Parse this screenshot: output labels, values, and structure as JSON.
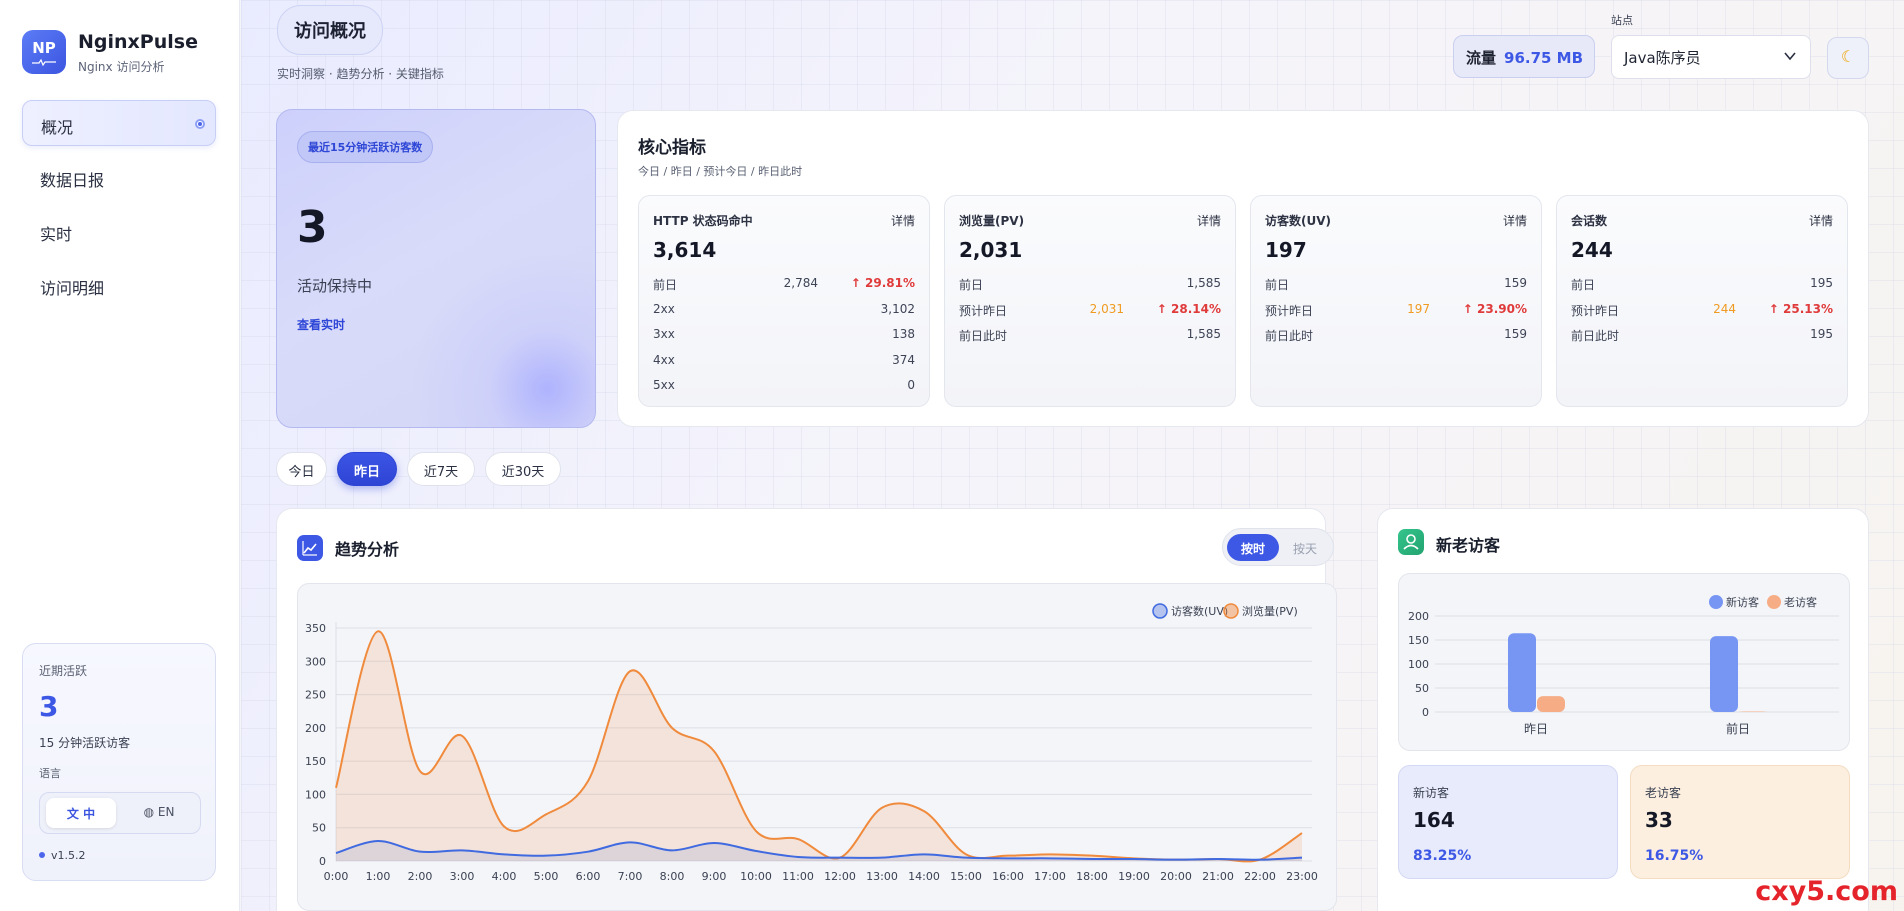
{
  "app": {
    "logo": "NP",
    "name": "NginxPulse",
    "subtitle": "Nginx 访问分析"
  },
  "nav": [
    {
      "label": "概况",
      "active": true
    },
    {
      "label": "数据日报",
      "active": false
    },
    {
      "label": "实时",
      "active": false
    },
    {
      "label": "访问明细",
      "active": false
    }
  ],
  "sidebar_card": {
    "title": "近期活跃",
    "value": "3",
    "desc": "15 分钟活跃访客",
    "lang_label": "语言",
    "lang_zh": "中",
    "lang_en": "EN",
    "version": "v1.5.2"
  },
  "header": {
    "title": "访问概况",
    "subtitle": "实时洞察 · 趋势分析 · 关键指标",
    "traffic_label": "流量",
    "traffic_value": "96.75 MB",
    "site_label": "站点",
    "site_value": "Java陈序员"
  },
  "active_card": {
    "badge": "最近15分钟活跃访客数",
    "value": "3",
    "status": "活动保持中",
    "link": "查看实时"
  },
  "core": {
    "title": "核心指标",
    "subtitle": "今日 / 昨日 / 预计今日 / 昨日此时",
    "detail_label": "详情",
    "metrics": [
      {
        "title": "HTTP 状态码命中",
        "value": "3,614",
        "rows": [
          {
            "label": "前日",
            "mid": "2,784",
            "right": "↑ 29.81%",
            "right_class": "red"
          },
          {
            "label": "2xx",
            "mid": "",
            "right": "3,102",
            "right_class": ""
          },
          {
            "label": "3xx",
            "mid": "",
            "right": "138",
            "right_class": ""
          },
          {
            "label": "4xx",
            "mid": "",
            "right": "374",
            "right_class": ""
          },
          {
            "label": "5xx",
            "mid": "",
            "right": "0",
            "right_class": ""
          }
        ]
      },
      {
        "title": "浏览量(PV)",
        "value": "2,031",
        "rows": [
          {
            "label": "前日",
            "mid": "",
            "right": "1,585",
            "right_class": ""
          },
          {
            "label": "预计昨日",
            "mid": "2,031",
            "right": "↑ 28.14%",
            "right_class": "red"
          },
          {
            "label": "前日此时",
            "mid": "",
            "right": "1,585",
            "right_class": ""
          }
        ]
      },
      {
        "title": "访客数(UV)",
        "value": "197",
        "rows": [
          {
            "label": "前日",
            "mid": "",
            "right": "159",
            "right_class": ""
          },
          {
            "label": "预计昨日",
            "mid": "197",
            "right": "↑ 23.90%",
            "right_class": "red"
          },
          {
            "label": "前日此时",
            "mid": "",
            "right": "159",
            "right_class": ""
          }
        ]
      },
      {
        "title": "会话数",
        "value": "244",
        "rows": [
          {
            "label": "前日",
            "mid": "",
            "right": "195",
            "right_class": ""
          },
          {
            "label": "预计昨日",
            "mid": "244",
            "right": "↑ 25.13%",
            "right_class": "red"
          },
          {
            "label": "前日此时",
            "mid": "",
            "right": "195",
            "right_class": ""
          }
        ]
      }
    ]
  },
  "range_tabs": [
    {
      "label": "今日",
      "selected": false
    },
    {
      "label": "昨日",
      "selected": true
    },
    {
      "label": "近7天",
      "selected": false
    },
    {
      "label": "近30天",
      "selected": false
    }
  ],
  "trend": {
    "title": "趋势分析",
    "toggle_on": "按时",
    "toggle_off": "按天"
  },
  "visitors": {
    "title": "新老访客",
    "new_label": "新访客",
    "new_value": "164",
    "new_pct": "83.25%",
    "old_label": "老访客",
    "old_value": "33",
    "old_pct": "16.75%"
  },
  "colors": {
    "accent": "#3e58e6",
    "uv_line": "#3f6ae0",
    "pv_line": "#f08a3c",
    "new_bar": "#7796f3",
    "old_bar": "#f6ad85"
  },
  "chart_data": [
    {
      "type": "area",
      "categories": [
        "0:00",
        "1:00",
        "2:00",
        "3:00",
        "4:00",
        "5:00",
        "6:00",
        "7:00",
        "8:00",
        "9:00",
        "10:00",
        "11:00",
        "12:00",
        "13:00",
        "14:00",
        "15:00",
        "16:00",
        "17:00",
        "18:00",
        "19:00",
        "20:00",
        "21:00",
        "22:00",
        "23:00"
      ],
      "series": [
        {
          "name": "访客数(UV)",
          "values": [
            12,
            30,
            14,
            16,
            10,
            8,
            14,
            28,
            16,
            27,
            15,
            6,
            5,
            5,
            10,
            5,
            4,
            4,
            3,
            3,
            2,
            3,
            2,
            5
          ]
        },
        {
          "name": "浏览量(PV)",
          "values": [
            110,
            345,
            135,
            188,
            52,
            70,
            120,
            285,
            200,
            165,
            45,
            33,
            5,
            80,
            75,
            10,
            8,
            10,
            8,
            4,
            2,
            3,
            2,
            42
          ]
        }
      ],
      "xlabel": "",
      "ylabel": "",
      "ylim": [
        0,
        350
      ],
      "yticks": [
        0,
        50,
        100,
        150,
        200,
        250,
        300,
        350
      ],
      "grid": true,
      "legend": "top-right"
    },
    {
      "type": "bar",
      "categories": [
        "昨日",
        "前日"
      ],
      "series": [
        {
          "name": "新访客",
          "values": [
            164,
            158
          ]
        },
        {
          "name": "老访客",
          "values": [
            33,
            1
          ]
        }
      ],
      "ylim": [
        0,
        200
      ],
      "yticks": [
        0,
        50,
        100,
        150,
        200
      ],
      "grid": true,
      "legend": "top-right"
    }
  ]
}
